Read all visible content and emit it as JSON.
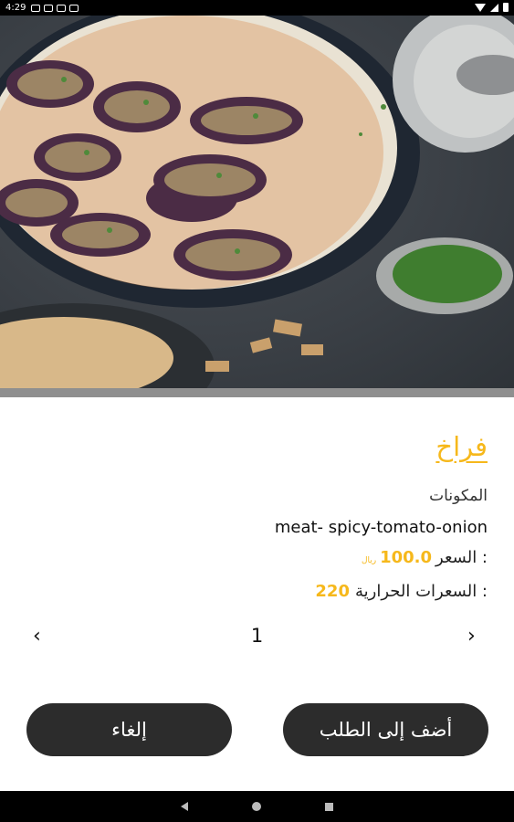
{
  "status_bar": {
    "time": "4:29"
  },
  "dish": {
    "title": "فراخ",
    "ingredients_label": "المكونات",
    "ingredients": "meat- spicy-tomato-onion",
    "price_label": "السعر :",
    "price": "100.0",
    "currency": "ريال",
    "calories_label": "السعرات الحرارية :",
    "calories": "220"
  },
  "quantity": {
    "value": "1",
    "left_arrow": "‹",
    "right_arrow": "›"
  },
  "actions": {
    "add_label": "أضف إلى الطلب",
    "cancel_label": "إلغاء"
  },
  "colors": {
    "accent": "#F6B81B",
    "button_bg": "#2c2c2c"
  }
}
